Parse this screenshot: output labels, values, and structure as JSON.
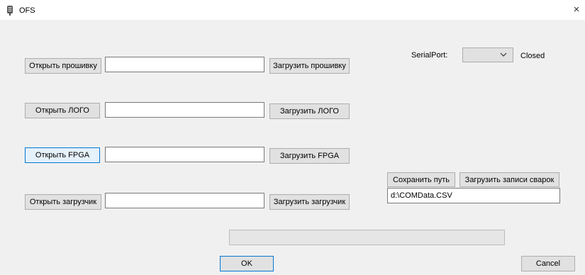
{
  "window": {
    "title": "OFS",
    "close_glyph": "×"
  },
  "firmware": {
    "open_label": "Открыть прошивку",
    "path": "",
    "load_label": "Загрузить прошивку"
  },
  "logo": {
    "open_label": "Открыть ЛОГО",
    "path": "",
    "load_label": "Загрузить ЛОГО"
  },
  "fpga": {
    "open_label": "Открыть FPGA",
    "path": "",
    "load_label": "Загрузить FPGA"
  },
  "bootloader": {
    "open_label": "Открыть загрузчик",
    "path": "",
    "load_label": "Загрузить загрузчик"
  },
  "serial": {
    "label": "SerialPort:",
    "selected": "",
    "status": "Closed"
  },
  "records": {
    "save_path_label": "Сохранить путь",
    "load_records_label": "Загрузить записи сварок",
    "path": "d:\\COMData.CSV"
  },
  "progress": {
    "value": 0
  },
  "footer": {
    "ok_label": "OK",
    "cancel_label": "Cancel"
  },
  "icons": {
    "app": "app-icon",
    "close": "close-icon",
    "dropdown": "chevron-down-icon"
  },
  "colors": {
    "focus_border": "#0078d7",
    "button_bg": "#e1e1e1",
    "window_bg": "#f0f0f0"
  }
}
